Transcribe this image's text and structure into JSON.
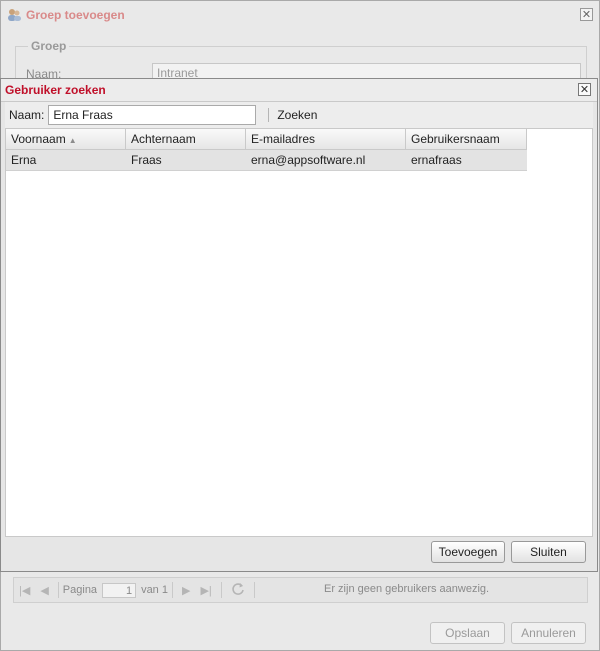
{
  "background_window": {
    "title": "Groep toevoegen",
    "close_glyph": "✕",
    "fieldset_legend": "Groep",
    "name_label": "Naam:",
    "name_value": "Intranet",
    "pager": {
      "page_label": "Pagina",
      "page_value": "1",
      "of_label": "van 1",
      "status": "Er zijn geen gebruikers aanwezig."
    },
    "buttons": {
      "save": "Opslaan",
      "cancel": "Annuleren"
    }
  },
  "dialog": {
    "title": "Gebruiker zoeken",
    "close_glyph": "✕",
    "search": {
      "label": "Naam:",
      "value": "Erna Fraas",
      "button": "Zoeken"
    },
    "columns": [
      "Voornaam",
      "Achternaam",
      "E-mailadres",
      "Gebruikersnaam"
    ],
    "sort_arrow": "▲",
    "rows": [
      {
        "first": "Erna",
        "last": "Fraas",
        "email": "erna@appsoftware.nl",
        "username": "ernafraas"
      }
    ],
    "buttons": {
      "add": "Toevoegen",
      "close": "Sluiten"
    }
  },
  "colors": {
    "dialog_title": "#c0102a",
    "bg_title": "#d98a8a"
  },
  "icons": [
    "users-icon",
    "close-icon",
    "first-page-icon",
    "prev-page-icon",
    "next-page-icon",
    "last-page-icon",
    "refresh-icon",
    "sort-asc-icon"
  ]
}
